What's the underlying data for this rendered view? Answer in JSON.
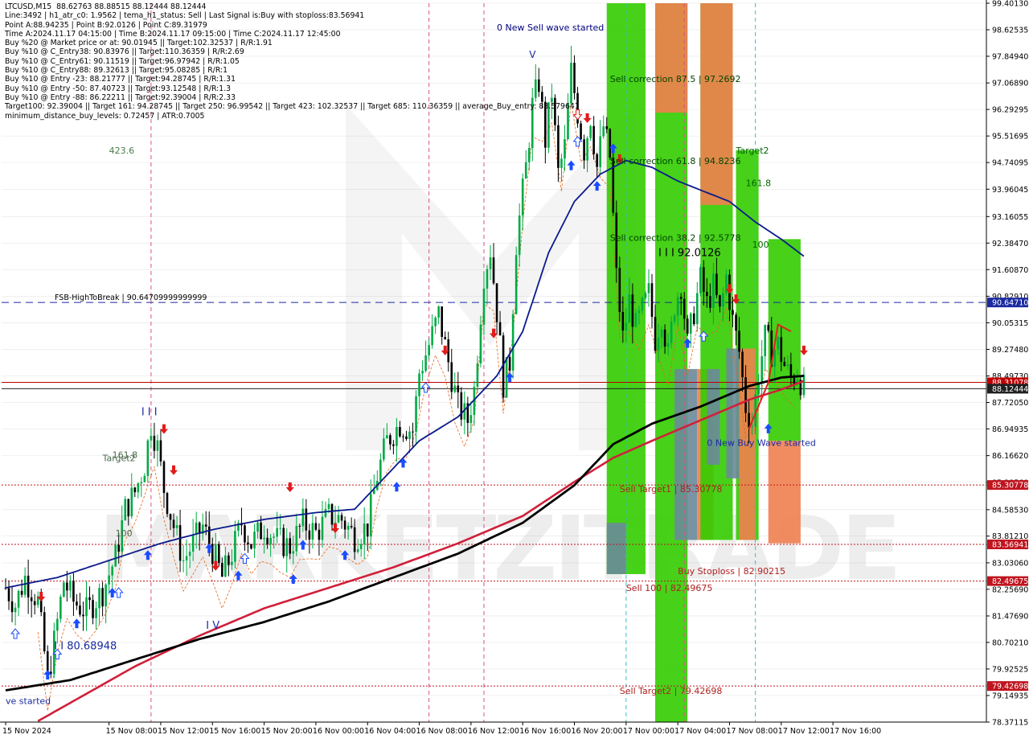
{
  "info_lines": [
    "LTCUSD,M15  88.62763 88.88515 88.12444 88.12444",
    "Line:3492 | h1_atr_c0: 1.9562 | tema_h1_status: Sell | Last Signal is:Buy with stoploss:83.56941",
    "Point A:88.94235 | Point B:92.0126 | Point C:89.31979",
    "Time A:2024.11.17 04:15:00 | Time B:2024.11.17 09:15:00 | Time C:2024.11.17 12:45:00",
    "Buy %20 @ Market price or at: 90.01945 || Target:102.32537 | R/R:1.91",
    "Buy %10 @ C_Entry38: 90.83976 || Target:110.36359 | R/R:2.69",
    "Buy %10 @ C_Entry61: 90.11519 || Target:96.97942 | R/R:1.05",
    "Buy %10 @ C_Entry88: 89.32613 || Target:95.08285 | R/R:1",
    "Buy %10 @ Entry -23: 88.21777 || Target:94.28745 | R/R:1.31",
    "Buy %10 @ Entry -50: 87.40723 || Target:93.12548 | R/R:1.3",
    "Buy %10 @ Entry -88: 86.22211 || Target:92.39004 | R/R:2.33",
    "Target100: 92.39004 || Target 161: 94.28745 || Target 250: 96.99542 || Target 423: 102.32537 || Target 685: 110.36359 || average_Buy_entry: 88.579641",
    "minimum_distance_buy_levels: 0.72457 | ATR:0.7005"
  ],
  "colors": {
    "background": "#ffffff",
    "grid": "#e6e6e6",
    "bull_candle": "#00aa44",
    "bear_candle": "#000000",
    "ma_black": "#000000",
    "ma_red": "#d0203a",
    "ma_blue": "#0a1a8c",
    "orange_line": "#e8661a",
    "zone_green": "#33cc00",
    "zone_orange": "#f08050",
    "zone_grey": "#6a8a9a",
    "buy_arrow": "#1a4cff",
    "sell_arrow": "#e31a1a",
    "level_red": "#c0141e",
    "level_blue": "#1a2aa0",
    "price_line": "#c00000",
    "vline_magenta": "#e0508a",
    "vline_cyan": "#30c0d0"
  },
  "watermark": "MARKETZITRADE",
  "chart_data": {
    "type": "candlestick",
    "symbol": "LTCUSD",
    "timeframe": "M15",
    "ylim": [
      78.37115,
      99.4013
    ],
    "y_ticks": [
      "99.40130",
      "98.62535",
      "97.84940",
      "97.06890",
      "96.29295",
      "95.51695",
      "94.74095",
      "93.96045",
      "93.16055",
      "92.38470",
      "91.60870",
      "90.82910",
      "90.05315",
      "89.27480",
      "88.49730",
      "87.72050",
      "86.94935",
      "86.16620",
      "85.38560",
      "84.58530",
      "83.81210",
      "83.03060",
      "82.25690",
      "81.47690",
      "80.70210",
      "79.92525",
      "79.14935",
      "78.37115"
    ],
    "x_ticks": [
      {
        "label": "15 Nov 2024",
        "bar": 0
      },
      {
        "label": "15 Nov 08:00",
        "bar": 32
      },
      {
        "label": "15 Nov 12:00",
        "bar": 48
      },
      {
        "label": "15 Nov 16:00",
        "bar": 64
      },
      {
        "label": "15 Nov 20:00",
        "bar": 80
      },
      {
        "label": "16 Nov 00:00",
        "bar": 96
      },
      {
        "label": "16 Nov 04:00",
        "bar": 112
      },
      {
        "label": "16 Nov 08:00",
        "bar": 128
      },
      {
        "label": "16 Nov 12:00",
        "bar": 144
      },
      {
        "label": "16 Nov 16:00",
        "bar": 160
      },
      {
        "label": "16 Nov 20:00",
        "bar": 176
      },
      {
        "label": "17 Nov 00:00",
        "bar": 192
      },
      {
        "label": "17 Nov 04:00",
        "bar": 208
      },
      {
        "label": "17 Nov 08:00",
        "bar": 224
      },
      {
        "label": "17 Nov 12:00",
        "bar": 240
      },
      {
        "label": "17 Nov 16:00",
        "bar": 256
      }
    ],
    "bar_count": 248,
    "last_bar_index": 247,
    "close_anchors": [
      [
        0,
        82.3
      ],
      [
        3,
        81.8
      ],
      [
        6,
        82.6
      ],
      [
        10,
        81.9
      ],
      [
        12,
        80.4
      ],
      [
        13,
        79.6
      ],
      [
        15,
        80.7
      ],
      [
        18,
        82.5
      ],
      [
        21,
        81.9
      ],
      [
        25,
        81.6
      ],
      [
        30,
        82.2
      ],
      [
        34,
        83.2
      ],
      [
        37,
        84.6
      ],
      [
        40,
        85.1
      ],
      [
        43,
        85.9
      ],
      [
        45,
        87.1
      ],
      [
        47,
        86.4
      ],
      [
        49,
        85.2
      ],
      [
        52,
        84.1
      ],
      [
        55,
        83.1
      ],
      [
        58,
        83.6
      ],
      [
        61,
        84.1
      ],
      [
        64,
        83.4
      ],
      [
        67,
        82.6
      ],
      [
        70,
        83.3
      ],
      [
        73,
        84.2
      ],
      [
        76,
        83.6
      ],
      [
        80,
        84.1
      ],
      [
        84,
        83.7
      ],
      [
        88,
        83.5
      ],
      [
        92,
        84.2
      ],
      [
        96,
        83.9
      ],
      [
        100,
        84.4
      ],
      [
        104,
        84.3
      ],
      [
        108,
        83.8
      ],
      [
        112,
        84.1
      ],
      [
        115,
        85.6
      ],
      [
        118,
        86.6
      ],
      [
        122,
        87.1
      ],
      [
        126,
        86.9
      ],
      [
        128,
        88.6
      ],
      [
        131,
        89.4
      ],
      [
        134,
        90.3
      ],
      [
        137,
        88.9
      ],
      [
        140,
        87.6
      ],
      [
        143,
        87.2
      ],
      [
        145,
        88.1
      ],
      [
        148,
        91.5
      ],
      [
        150,
        92.2
      ],
      [
        152,
        90.4
      ],
      [
        154,
        88.3
      ],
      [
        156,
        88.9
      ],
      [
        158,
        92.4
      ],
      [
        161,
        94.6
      ],
      [
        163,
        96.4
      ],
      [
        165,
        97.1
      ],
      [
        167,
        95.4
      ],
      [
        169,
        96.8
      ],
      [
        171,
        94.4
      ],
      [
        173,
        95.2
      ],
      [
        175,
        97.4
      ],
      [
        177,
        96.2
      ],
      [
        179,
        95.1
      ],
      [
        181,
        96.1
      ],
      [
        183,
        94.6
      ],
      [
        185,
        95.8
      ],
      [
        187,
        94.9
      ],
      [
        189,
        91.4
      ],
      [
        191,
        89.6
      ],
      [
        193,
        90.7
      ],
      [
        195,
        89.9
      ],
      [
        197,
        90.4
      ],
      [
        199,
        90.9
      ],
      [
        201,
        89.6
      ],
      [
        203,
        90.3
      ],
      [
        205,
        89.1
      ],
      [
        207,
        90.6
      ],
      [
        209,
        91.2
      ],
      [
        211,
        89.4
      ],
      [
        213,
        90.4
      ],
      [
        215,
        91.3
      ],
      [
        217,
        90.6
      ],
      [
        219,
        91.1
      ],
      [
        221,
        90.3
      ],
      [
        223,
        91.4
      ],
      [
        225,
        90.1
      ],
      [
        227,
        89.2
      ],
      [
        229,
        87.6
      ],
      [
        231,
        87.1
      ],
      [
        233,
        88.6
      ],
      [
        235,
        89.6
      ],
      [
        237,
        89.2
      ],
      [
        239,
        89.4
      ],
      [
        241,
        88.8
      ],
      [
        243,
        88.4
      ],
      [
        245,
        88.6
      ],
      [
        247,
        88.12444
      ]
    ],
    "ma_black_anchors": [
      [
        0,
        79.3
      ],
      [
        20,
        79.6
      ],
      [
        40,
        80.2
      ],
      [
        60,
        80.8
      ],
      [
        80,
        81.3
      ],
      [
        100,
        81.9
      ],
      [
        120,
        82.6
      ],
      [
        140,
        83.3
      ],
      [
        160,
        84.2
      ],
      [
        176,
        85.3
      ],
      [
        188,
        86.5
      ],
      [
        200,
        87.1
      ],
      [
        215,
        87.6
      ],
      [
        230,
        88.2
      ],
      [
        240,
        88.45
      ],
      [
        247,
        88.5
      ]
    ],
    "ma_red_anchors": [
      [
        10,
        78.4
      ],
      [
        25,
        79.2
      ],
      [
        40,
        80.0
      ],
      [
        60,
        80.9
      ],
      [
        80,
        81.7
      ],
      [
        100,
        82.3
      ],
      [
        120,
        82.9
      ],
      [
        140,
        83.6
      ],
      [
        160,
        84.4
      ],
      [
        176,
        85.4
      ],
      [
        188,
        86.1
      ],
      [
        200,
        86.6
      ],
      [
        215,
        87.2
      ],
      [
        230,
        87.8
      ],
      [
        240,
        88.1
      ],
      [
        247,
        88.35
      ]
    ],
    "ma_blue_anchors": [
      [
        0,
        82.3
      ],
      [
        16,
        82.6
      ],
      [
        32,
        83.1
      ],
      [
        48,
        83.6
      ],
      [
        64,
        84.0
      ],
      [
        80,
        84.3
      ],
      [
        96,
        84.5
      ],
      [
        108,
        84.6
      ],
      [
        116,
        85.4
      ],
      [
        128,
        86.6
      ],
      [
        140,
        87.3
      ],
      [
        152,
        88.5
      ],
      [
        160,
        89.8
      ],
      [
        168,
        92.1
      ],
      [
        176,
        93.6
      ],
      [
        184,
        94.4
      ],
      [
        192,
        94.8
      ],
      [
        200,
        94.6
      ],
      [
        208,
        94.2
      ],
      [
        216,
        93.9
      ],
      [
        224,
        93.6
      ],
      [
        232,
        93.0
      ],
      [
        240,
        92.5
      ],
      [
        247,
        92.0
      ]
    ],
    "levels": [
      {
        "label": "FSB-HighToBreak | 90.64709999999999",
        "value": 90.6471,
        "axis_label": "90.64710",
        "color": "#1a2aa0",
        "style": "dashed"
      },
      {
        "label": "",
        "value": 88.31078,
        "axis_label": "88.31078",
        "color": "#c00000",
        "style": "solid"
      },
      {
        "label": "",
        "value": 88.12444,
        "axis_label": "88.12444",
        "color": "#202020",
        "style": "solid"
      },
      {
        "label": "",
        "value": 85.30778,
        "axis_label": "85.30778",
        "color": "#c0141e",
        "style": "dotted"
      },
      {
        "label": "",
        "value": 83.56941,
        "axis_label": "83.56941",
        "color": "#c0141e",
        "style": "dotted"
      },
      {
        "label": "",
        "value": 82.49675,
        "axis_label": "82.49675",
        "color": "#c0141e",
        "style": "dotted"
      },
      {
        "label": "",
        "value": 79.42698,
        "axis_label": "79.42698",
        "color": "#c0141e",
        "style": "dotted"
      }
    ],
    "zones": [
      {
        "bar_start": 186,
        "bar_end": 198,
        "y_top": 99.4013,
        "y_bottom": 82.7,
        "color": "green"
      },
      {
        "bar_start": 186,
        "bar_end": 192,
        "y_top": 84.2,
        "y_bottom": 82.7,
        "color": "grey"
      },
      {
        "bar_start": 201,
        "bar_end": 211,
        "y_top": 99.4013,
        "y_bottom": 78.37115,
        "color": "green"
      },
      {
        "bar_start": 201,
        "bar_end": 211,
        "y_top": 99.4013,
        "y_bottom": 96.2,
        "color": "orange"
      },
      {
        "bar_start": 207,
        "bar_end": 214,
        "y_top": 88.7,
        "y_bottom": 83.7,
        "color": "grey"
      },
      {
        "bar_start": 214,
        "bar_end": 219,
        "y_top": 88.7,
        "y_bottom": 83.7,
        "color": "orange"
      },
      {
        "bar_start": 215,
        "bar_end": 225,
        "y_top": 99.4013,
        "y_bottom": 83.7,
        "color": "green"
      },
      {
        "bar_start": 215,
        "bar_end": 225,
        "y_top": 99.4013,
        "y_bottom": 93.5,
        "color": "orange"
      },
      {
        "bar_start": 217,
        "bar_end": 221,
        "y_top": 88.7,
        "y_bottom": 85.9,
        "color": "grey"
      },
      {
        "bar_start": 226,
        "bar_end": 233,
        "y_top": 95.1,
        "y_bottom": 83.7,
        "color": "green"
      },
      {
        "bar_start": 223,
        "bar_end": 227,
        "y_top": 89.3,
        "y_bottom": 85.5,
        "color": "grey"
      },
      {
        "bar_start": 227,
        "bar_end": 232,
        "y_top": 89.3,
        "y_bottom": 83.7,
        "color": "orange"
      },
      {
        "bar_start": 236,
        "bar_end": 246,
        "y_top": 92.5,
        "y_bottom": 86.6,
        "color": "green"
      },
      {
        "bar_start": 236,
        "bar_end": 246,
        "y_top": 86.6,
        "y_bottom": 83.6,
        "color": "orange"
      }
    ],
    "magenta_vlines": [
      45,
      131,
      148,
      210
    ],
    "cyan_vlines": [
      192,
      232
    ],
    "buy_arrows": [
      [
        13,
        79.9
      ],
      [
        22,
        81.4
      ],
      [
        33,
        82.3
      ],
      [
        44,
        83.4
      ],
      [
        63,
        83.6
      ],
      [
        72,
        82.8
      ],
      [
        89,
        82.7
      ],
      [
        92,
        83.7
      ],
      [
        105,
        83.4
      ],
      [
        121,
        85.4
      ],
      [
        123,
        86.1
      ],
      [
        156,
        88.6
      ],
      [
        175,
        94.8
      ],
      [
        183,
        94.2
      ],
      [
        188,
        95.3
      ],
      [
        211,
        89.6
      ],
      [
        236,
        87.1
      ]
    ],
    "sell_arrows": [
      [
        11,
        81.9
      ],
      [
        49,
        86.8
      ],
      [
        52,
        85.6
      ],
      [
        65,
        82.8
      ],
      [
        88,
        85.1
      ],
      [
        102,
        83.9
      ],
      [
        136,
        89.1
      ],
      [
        151,
        89.6
      ],
      [
        180,
        95.9
      ],
      [
        190,
        94.7
      ],
      [
        224,
        90.9
      ],
      [
        226,
        90.6
      ],
      [
        247,
        89.1
      ]
    ],
    "hollow_buy_arrows": [
      [
        3,
        81.1
      ],
      [
        16,
        80.5
      ],
      [
        35,
        82.3
      ],
      [
        74,
        83.3
      ],
      [
        130,
        88.3
      ],
      [
        177,
        95.5
      ],
      [
        216,
        89.8
      ]
    ],
    "hollow_sell_arrows": [
      [
        177,
        96.0
      ]
    ],
    "chart_labels": [
      {
        "text": "0 New Sell wave started",
        "bar": 152,
        "y": 98.6,
        "color": "#000080",
        "size": 11
      },
      {
        "text": "V",
        "bar": 162,
        "y": 97.8,
        "color": "#1a2aa0",
        "size": 12
      },
      {
        "text": "Sell correction 87.5 | 97.2692",
        "bar": 187,
        "y": 97.1,
        "color": "#004400",
        "size": 11
      },
      {
        "text": "Sell correction 61.8 | 94.8236",
        "bar": 187,
        "y": 94.7,
        "color": "#004400",
        "size": 11
      },
      {
        "text": "Sell correction 38.2 | 92.5778",
        "bar": 187,
        "y": 92.45,
        "color": "#004400",
        "size": 11
      },
      {
        "text": "Target2",
        "bar": 226,
        "y": 95.0,
        "color": "#006600",
        "size": 11
      },
      {
        "text": "161.8",
        "bar": 229,
        "y": 94.05,
        "color": "#006600",
        "size": 11
      },
      {
        "text": "100",
        "bar": 231,
        "y": 92.25,
        "color": "#006600",
        "size": 11
      },
      {
        "text": "I I I 92.0126",
        "bar": 202,
        "y": 92.0,
        "color": "#000000",
        "size": 13
      },
      {
        "text": "423.6",
        "bar": 32,
        "y": 95.0,
        "color": "#4a7a4a",
        "size": 11
      },
      {
        "text": "I I I",
        "bar": 42,
        "y": 87.35,
        "color": "#1a2aa0",
        "size": 13
      },
      {
        "text": "Target2",
        "bar": 30,
        "y": 86.0,
        "color": "#4a6a4a",
        "size": 11
      },
      {
        "text": "161.8",
        "bar": 33,
        "y": 86.1,
        "color": "#4a6a4a",
        "size": 11
      },
      {
        "text": "100",
        "bar": 34,
        "y": 83.8,
        "color": "#4a6a4a",
        "size": 11
      },
      {
        "text": "I V",
        "bar": 62,
        "y": 81.1,
        "color": "#1a2aa0",
        "size": 13
      },
      {
        "text": "I I 80.68948",
        "bar": 15,
        "y": 80.5,
        "color": "#1a2aa0",
        "size": 13
      },
      {
        "text": "ve started",
        "bar": 0,
        "y": 78.9,
        "color": "#1a2aa0",
        "size": 11
      },
      {
        "text": "0 New Buy Wave started",
        "bar": 217,
        "y": 86.45,
        "color": "#1a2aa0",
        "size": 11
      },
      {
        "text": "Sell Target1 | 85.30778",
        "bar": 190,
        "y": 85.1,
        "color": "#b02020",
        "size": 11
      },
      {
        "text": "Buy Stoploss | 82.90215",
        "bar": 208,
        "y": 82.7,
        "color": "#b02020",
        "size": 11
      },
      {
        "text": "Sell 100 | 82.49675",
        "bar": 192,
        "y": 82.2,
        "color": "#b02020",
        "size": 11
      },
      {
        "text": "Sell Target2 | 79.42698",
        "bar": 190,
        "y": 79.2,
        "color": "#b02020",
        "size": 11
      }
    ]
  }
}
